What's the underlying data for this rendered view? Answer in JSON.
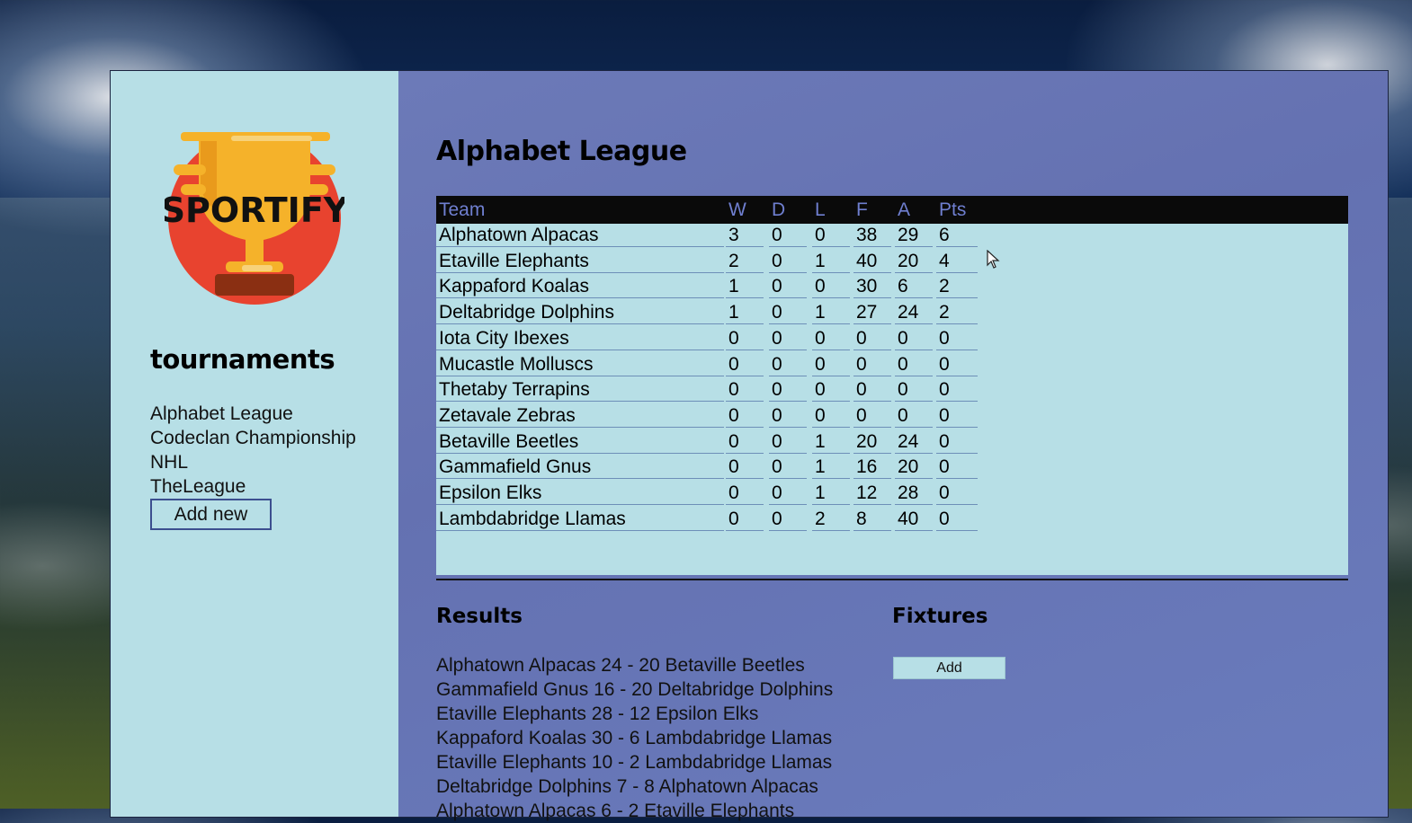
{
  "brand": {
    "logo_text": "SPORTIFY",
    "colors": {
      "red": "#e8432f",
      "gold": "#f5b22a",
      "brown": "#8a2f12"
    }
  },
  "sidebar": {
    "title": "tournaments",
    "tournaments": [
      "Alphabet League",
      "Codeclan Championship",
      "NHL",
      "TheLeague"
    ],
    "add_new_label": "Add new"
  },
  "league": {
    "title": "Alphabet League",
    "headers": [
      "Team",
      "W",
      "D",
      "L",
      "F",
      "A",
      "Pts"
    ],
    "rows": [
      [
        "Alphatown Alpacas",
        "3",
        "0",
        "0",
        "38",
        "29",
        "6"
      ],
      [
        "Etaville Elephants",
        "2",
        "0",
        "1",
        "40",
        "20",
        "4"
      ],
      [
        "Kappaford Koalas",
        "1",
        "0",
        "0",
        "30",
        "6",
        "2"
      ],
      [
        "Deltabridge Dolphins",
        "1",
        "0",
        "1",
        "27",
        "24",
        "2"
      ],
      [
        "Iota City Ibexes",
        "0",
        "0",
        "0",
        "0",
        "0",
        "0"
      ],
      [
        "Mucastle Molluscs",
        "0",
        "0",
        "0",
        "0",
        "0",
        "0"
      ],
      [
        "Thetaby Terrapins",
        "0",
        "0",
        "0",
        "0",
        "0",
        "0"
      ],
      [
        "Zetavale Zebras",
        "0",
        "0",
        "0",
        "0",
        "0",
        "0"
      ],
      [
        "Betaville Beetles",
        "0",
        "0",
        "1",
        "20",
        "24",
        "0"
      ],
      [
        "Gammafield Gnus",
        "0",
        "0",
        "1",
        "16",
        "20",
        "0"
      ],
      [
        "Epsilon Elks",
        "0",
        "0",
        "1",
        "12",
        "28",
        "0"
      ],
      [
        "Lambdabridge Llamas",
        "0",
        "0",
        "2",
        "8",
        "40",
        "0"
      ]
    ]
  },
  "results": {
    "title": "Results",
    "items": [
      "Alphatown Alpacas 24 - 20 Betaville Beetles",
      "Gammafield Gnus 16 - 20 Deltabridge Dolphins",
      "Etaville Elephants 28 - 12 Epsilon Elks",
      "Kappaford Koalas 30 - 6 Lambdabridge Llamas",
      "Etaville Elephants 10 - 2 Lambdabridge Llamas",
      "Deltabridge Dolphins 7 - 8 Alphatown Alpacas",
      "Alphatown Alpacas 6 - 2 Etaville Elephants"
    ]
  },
  "fixtures": {
    "title": "Fixtures",
    "add_label": "Add"
  }
}
